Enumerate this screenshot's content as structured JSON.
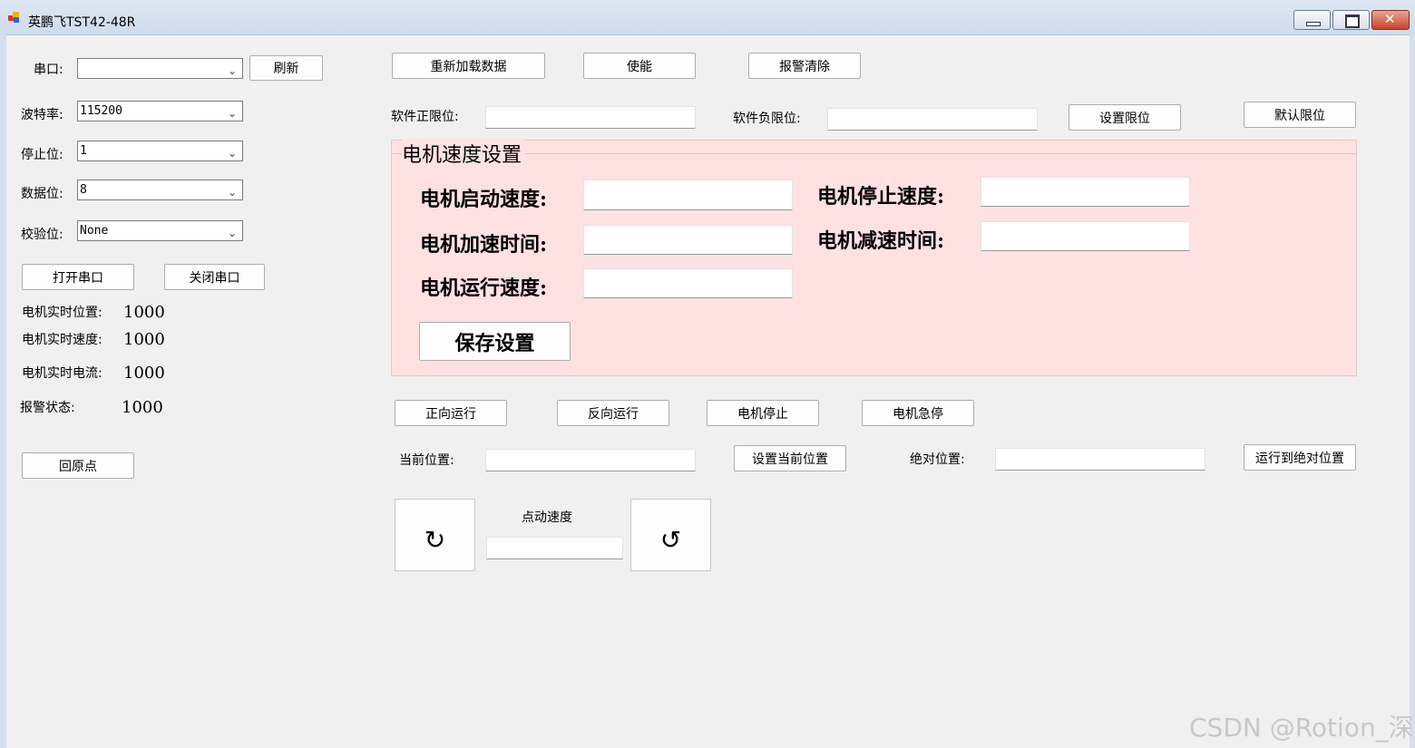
{
  "window": {
    "title": "英鹏飞TST42-48R",
    "minimize_label": "▬",
    "maximize_label": "□",
    "close_label": "✕"
  },
  "serial": {
    "port_label": "串口:",
    "port_value": "",
    "refresh_label": "刷新",
    "baud_label": "波特率:",
    "baud_value": "115200",
    "stop_label": "停止位:",
    "stop_value": "1",
    "data_label": "数据位:",
    "data_value": "8",
    "parity_label": "校验位:",
    "parity_value": "None",
    "open_label": "打开串口",
    "close_label": "关闭串口"
  },
  "status": {
    "position_label": "电机实时位置:",
    "position_value": "1000",
    "speed_label": "电机实时速度:",
    "speed_value": "1000",
    "current_label": "电机实时电流:",
    "current_value": "1000",
    "alarm_label": "报警状态:",
    "alarm_value": "1000",
    "home_label": "回原点"
  },
  "top_buttons": {
    "reload_label": "重新加载数据",
    "enable_label": "使能",
    "clear_alarm_label": "报警清除"
  },
  "limits": {
    "positive_label": "软件正限位:",
    "positive_value": "",
    "negative_label": "软件负限位:",
    "negative_value": "",
    "set_label": "设置限位",
    "default_label": "默认限位"
  },
  "speed_group": {
    "title": "电机速度设置",
    "start_speed_label": "电机启动速度:",
    "start_speed_value": "",
    "stop_speed_label": "电机停止速度:",
    "stop_speed_value": "",
    "accel_label": "电机加速时间:",
    "accel_value": "",
    "decel_label": "电机减速时间:",
    "decel_value": "",
    "run_speed_label": "电机运行速度:",
    "run_speed_value": "",
    "save_label": "保存设置"
  },
  "motion": {
    "forward_label": "正向运行",
    "reverse_label": "反向运行",
    "stop_label": "电机停止",
    "estop_label": "电机急停",
    "current_pos_label": "当前位置:",
    "current_pos_value": "",
    "set_current_label": "设置当前位置",
    "abs_pos_label": "绝对位置:",
    "abs_pos_value": "",
    "run_abs_label": "运行到绝对位置"
  },
  "jog": {
    "speed_label": "点动速度",
    "speed_value": "",
    "cw_glyph": "↻",
    "ccw_glyph": "↺"
  },
  "watermark": "CSDN @Rotion_深",
  "icons": {
    "app": "app-icon",
    "dropdown": "chevron-down-icon"
  }
}
